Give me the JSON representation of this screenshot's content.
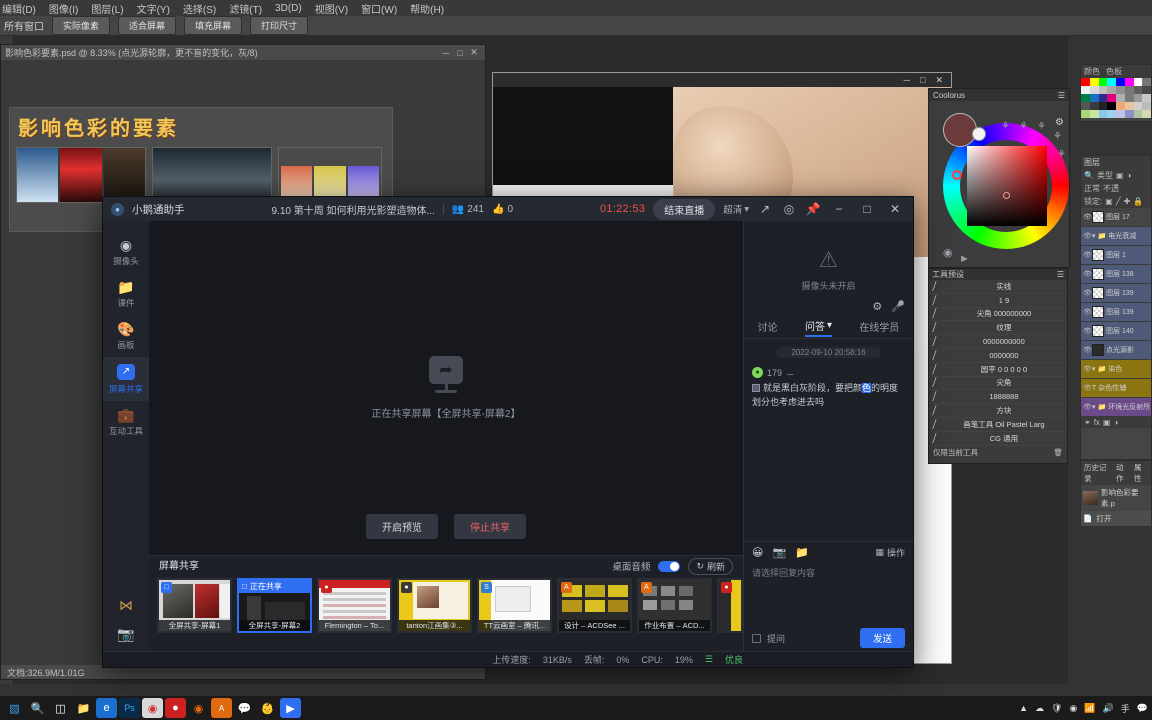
{
  "photoshop": {
    "menus": [
      "编辑(D)",
      "图像(I)",
      "图层(L)",
      "文字(Y)",
      "选择(S)",
      "滤镜(T)",
      "3D(D)",
      "视图(V)",
      "窗口(W)",
      "帮助(H)"
    ],
    "option_bar": {
      "label": "所有窗口",
      "buttons": [
        "实际像素",
        "适合屏幕",
        "填充屏幕",
        "打印尺寸"
      ]
    },
    "document": {
      "title": "影响色彩要素.psd @ 8.33% (点光源轮廓，更不盲的变化，灰/8)",
      "status": "文档:326.9M/1.01G",
      "slide_title": "影响色彩的要素"
    },
    "coolorus": {
      "title": "Coolorus"
    },
    "tool_presets": {
      "title": "工具预设",
      "footer": "仅限当前工具",
      "items": [
        "实线",
        "1      9",
        "尖角 000000000",
        "纹理",
        "0000000000",
        "0000000",
        "圆平 0 0 0 0 0",
        "尖角",
        "1888888",
        "方块",
        "画笔工具 Oil Pastel Larg",
        "CG 通用"
      ]
    },
    "swatches": {
      "tabs": [
        "颜色",
        "色板"
      ]
    },
    "layers": {
      "title": "图层",
      "filter_label": "类型",
      "blend_mode": "正常",
      "opacity_label": "不透",
      "lock_label": "锁定:",
      "rows": [
        {
          "name": "图层 17",
          "kind": "layer"
        },
        {
          "name": "电光衰减",
          "kind": "group"
        },
        {
          "name": "图层 1",
          "kind": "layer"
        },
        {
          "name": "图层 138",
          "kind": "layer"
        },
        {
          "name": "图层 139",
          "kind": "layer"
        },
        {
          "name": "图层 139",
          "kind": "layer"
        },
        {
          "name": "图层 140",
          "kind": "layer"
        },
        {
          "name": "点光源影",
          "kind": "layer"
        },
        {
          "name": "染色",
          "kind": "group-yellow"
        },
        {
          "name": "杂色性辅",
          "kind": "text"
        },
        {
          "name": "环境光反射所",
          "kind": "group-purple"
        }
      ]
    },
    "history": {
      "tabs": [
        "历史记录",
        "动作",
        "属性"
      ],
      "items": [
        "影响色彩要素.p",
        "打开"
      ]
    }
  },
  "live_app": {
    "title_bar": {
      "app_name": "小鹅通助手",
      "course_name": "9.10 第十周 如何利用光影塑造物体...",
      "viewers": "241",
      "likes": "0",
      "timer": "01:22:53",
      "end_live_label": "结束直播",
      "quality": "超清",
      "icons": [
        "share-icon",
        "record-icon",
        "pin-icon",
        "minimize-icon",
        "maximize-icon",
        "close-icon"
      ]
    },
    "rail": [
      {
        "label": "摄像头",
        "icon": "camera-icon",
        "active": false
      },
      {
        "label": "课件",
        "icon": "folder-icon",
        "active": false
      },
      {
        "label": "画板",
        "icon": "palette-icon",
        "active": false
      },
      {
        "label": "屏幕共享",
        "icon": "screen-share-icon",
        "active": true
      },
      {
        "label": "互动工具",
        "icon": "toolbox-icon",
        "active": false
      }
    ],
    "stage": {
      "sharing_text": "正在共享屏幕【全屏共享-屏幕2】",
      "preview_button": "开启预览",
      "stop_button": "停止共享"
    },
    "picker": {
      "tab": "屏幕共享",
      "audio_label": "桌面音频",
      "audio_on": true,
      "refresh_label": "刷新",
      "sharing_badge": "正在共享",
      "sources": [
        {
          "caption": "全屏共享-屏幕1",
          "selected": false,
          "type": "screen"
        },
        {
          "caption": "全屏共享-屏幕2",
          "selected": true,
          "type": "screen"
        },
        {
          "caption": "Flemington – To...",
          "selected": false,
          "type": "app-red"
        },
        {
          "caption": "tanton江画集③...",
          "selected": false,
          "type": "app-yellow"
        },
        {
          "caption": "TT云画室 – 腾讯...",
          "selected": false,
          "type": "app-blue"
        },
        {
          "caption": "设计 – ACDSee ...",
          "selected": false,
          "type": "app-orange"
        },
        {
          "caption": "作业布置 – ACD...",
          "selected": false,
          "type": "app-orange"
        },
        {
          "caption": "",
          "selected": false,
          "type": "app-yellow"
        }
      ]
    },
    "chat": {
      "camera_off_text": "摄像头未开启",
      "camera_controls": [
        "settings-icon",
        "microphone-icon"
      ],
      "tabs": [
        {
          "label": "讨论",
          "active": false,
          "caret": false
        },
        {
          "label": "问答",
          "active": true,
          "caret": true
        },
        {
          "label": "在线学员",
          "active": false,
          "caret": false
        }
      ],
      "timestamp": "2022-09-10 20:58:16",
      "message": {
        "author": "179",
        "text_before": "就是黑白灰阶段，要把颜",
        "text_highlight": "色",
        "text_after": "的明度划分也考虑进去吗"
      },
      "input": {
        "placeholder": "请选择回复内容",
        "operation_label": "操作",
        "checkbox_label": "提问",
        "send_label": "发送",
        "toolbar_icons": [
          "emoji-icon",
          "image-icon",
          "folder-icon",
          "grid-icon"
        ]
      }
    },
    "status_bar": {
      "upload_label": "上传速度:",
      "upload_value": "31KB/s",
      "drop_label": "丢帧:",
      "drop_value": "0%",
      "cpu_label": "CPU:",
      "cpu_value": "19%",
      "quality_label": "优良"
    }
  },
  "taskbar": {
    "icons": [
      "windows-icon",
      "search-icon",
      "taskview-icon",
      "explorer-icon",
      "edge-icon",
      "photoshop-icon",
      "chrome-icon",
      "record-icon",
      "firefox-icon",
      "acdsee-icon",
      "wechat-icon",
      "qq-icon",
      "livestream-icon"
    ],
    "tray": [
      "up-arrow-icon",
      "cloud-icon",
      "shield-icon",
      "network-icon",
      "volume-icon",
      "ime-icon",
      "notification-icon"
    ]
  },
  "colors": {
    "accent": "#2f6ef0",
    "danger": "#f05050",
    "good": "#4cc76a",
    "app_bg": "#1d2027",
    "ps_bg": "#333333"
  }
}
